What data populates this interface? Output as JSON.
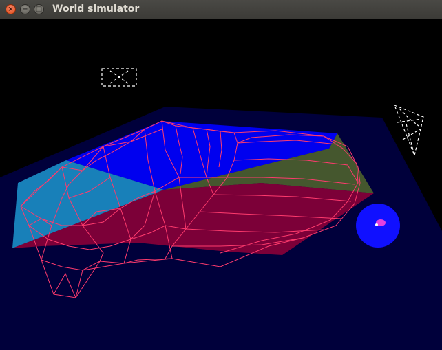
{
  "window": {
    "title": "World simulator",
    "close_glyph": "×",
    "minimize_glyph": "−",
    "maximize_glyph": "□"
  },
  "scene": {
    "description_icon": "3d-viewport",
    "colors": {
      "background": "#000000",
      "ground": "#00003b",
      "quad_blue": "#0000ff",
      "quad_cyan": "#1a8bc4",
      "quad_green": "#4b5e2e",
      "quad_crimson": "#8a0038",
      "wireframe": "#ff3b6e",
      "sphere": "#1010ff",
      "agent": "#e040e0",
      "camera_markers": "#ffffff"
    }
  }
}
